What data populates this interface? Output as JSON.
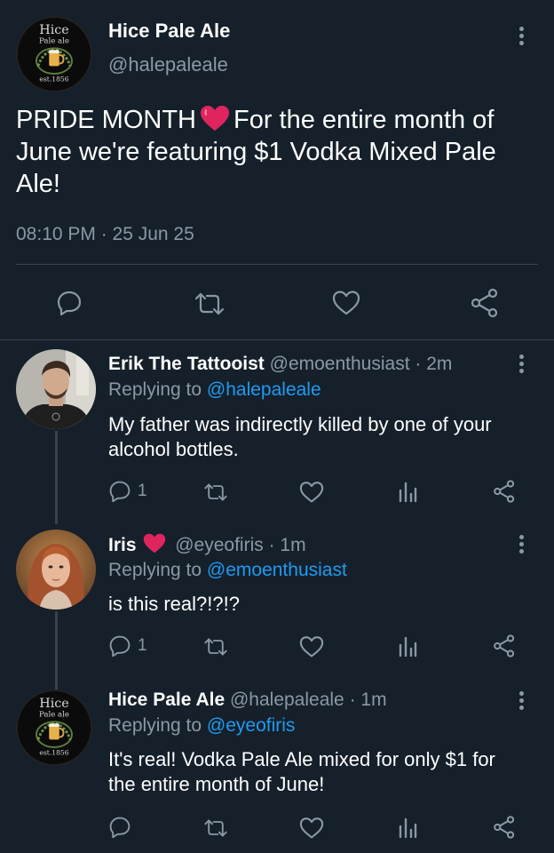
{
  "main_tweet": {
    "display_name": "Hice Pale Ale",
    "handle": "@halepaleale",
    "text_before_emoji": "PRIDE MONTH",
    "text_after_emoji": "For the entire month of June we're featuring $1 Vodka Mixed Pale Ale!",
    "timestamp": "08:10 PM · 25 Jun 25",
    "logo": {
      "line1": "Hice",
      "line2": "Pale ale",
      "line3": "est.1856"
    }
  },
  "replies": [
    {
      "display_name": "Erik The Tattooist",
      "meta": "@emoenthusiast · 2m",
      "replying_prefix": "Replying to",
      "replying_to": "@halepaleale",
      "text": "My father was indirectly killed by one of your alcohol bottles.",
      "reply_count": "1"
    },
    {
      "display_name": "Iris",
      "meta": "@eyeofiris · 1m",
      "replying_prefix": "Replying to",
      "replying_to": "@emoenthusiast",
      "text": "is this real?!?!?",
      "reply_count": "1"
    },
    {
      "display_name": "Hice Pale Ale",
      "meta": "@halepaleale · 1m",
      "replying_prefix": "Replying to",
      "replying_to": "@eyeofiris",
      "text": "It's real! Vodka Pale Ale mixed for only $1 for the entire month of June!",
      "reply_count": ""
    }
  ],
  "colors": {
    "background": "#15202b",
    "secondary_text": "#8b98a5",
    "link": "#1d9bf0",
    "divider": "#38444d",
    "heart": "#e0245e"
  }
}
